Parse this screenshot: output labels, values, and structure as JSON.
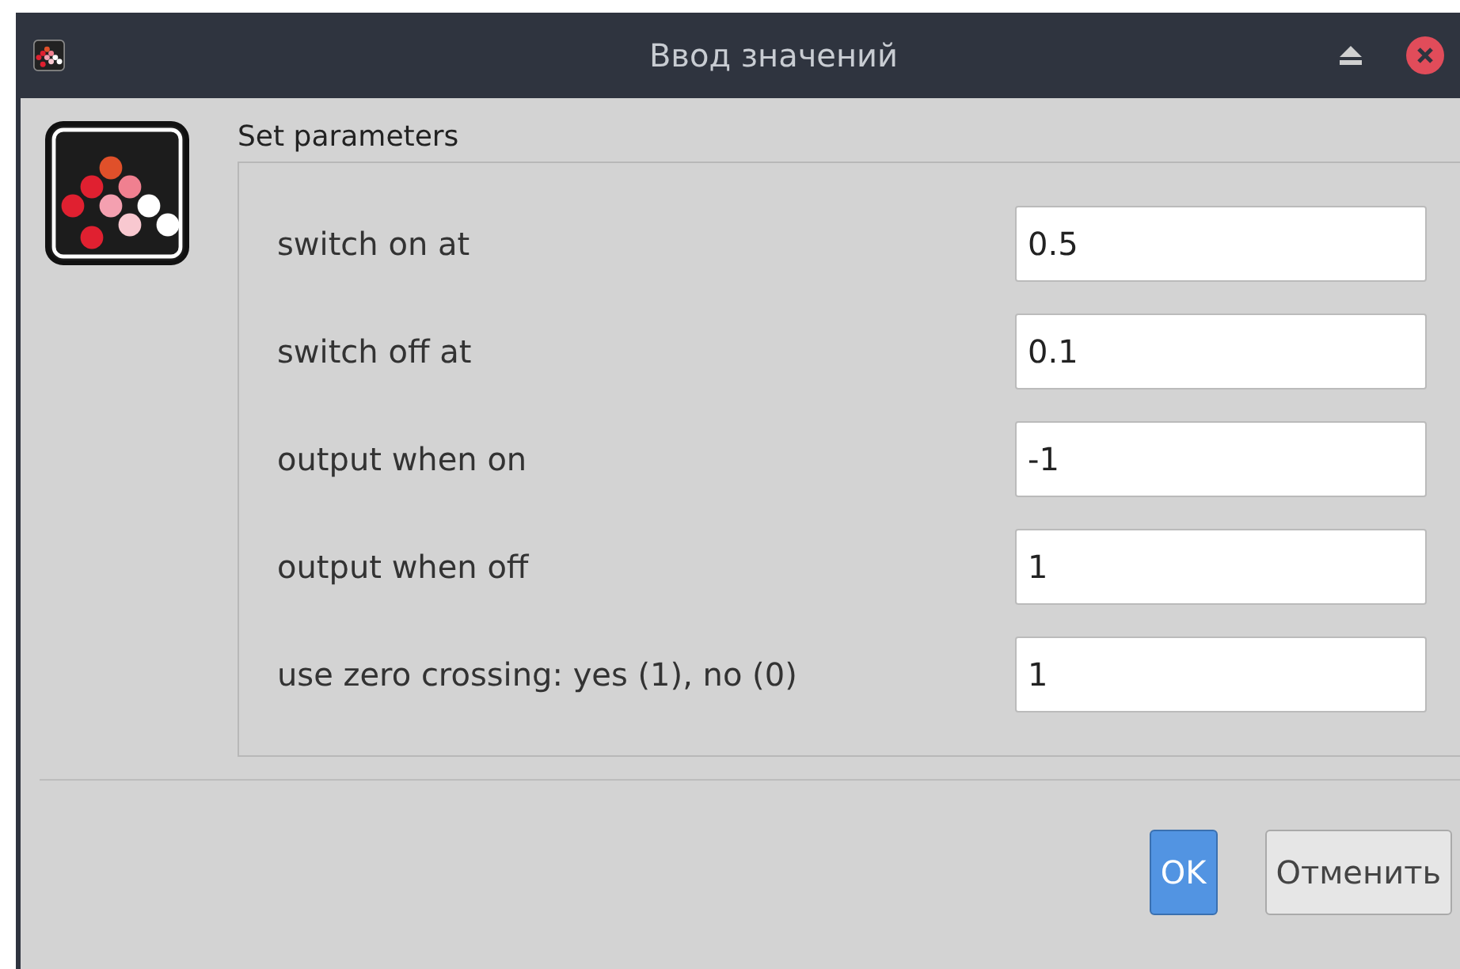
{
  "window": {
    "title": "Ввод значений"
  },
  "group": {
    "title": "Set parameters"
  },
  "fields": [
    {
      "label": "switch on at",
      "value": "0.5"
    },
    {
      "label": "switch off at",
      "value": "0.1"
    },
    {
      "label": "output when on",
      "value": "-1"
    },
    {
      "label": "output when off",
      "value": "1"
    },
    {
      "label": "use zero crossing: yes (1), no (0)",
      "value": "1"
    }
  ],
  "buttons": [
    {
      "label": "OK",
      "default": true
    },
    {
      "label": "Отменить",
      "default": false
    }
  ]
}
